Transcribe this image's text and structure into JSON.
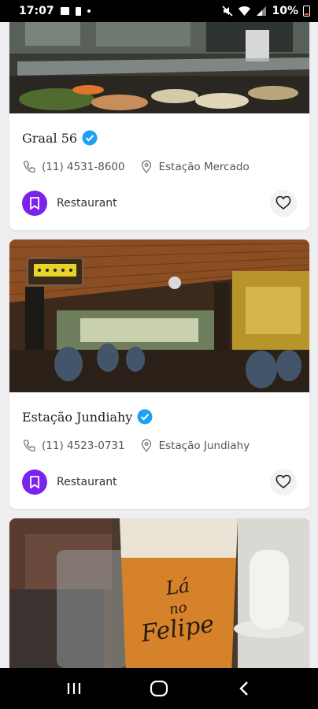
{
  "status_bar": {
    "time": "17:07",
    "battery_percent": "10%",
    "icons": [
      "photo-icon",
      "battery-small-icon",
      "dot-icon",
      "mute-icon",
      "wifi-icon",
      "signal-icon",
      "battery-icon"
    ]
  },
  "cards": [
    {
      "title": "Graal 56",
      "verified": true,
      "phone": "(11) 4531-8600",
      "location": "Estação Mercado",
      "category": "Restaurant",
      "image_desc_icon": "buffet-photo"
    },
    {
      "title": "Estação Jundiahy",
      "verified": true,
      "phone": "(11) 4523-0731",
      "location": "Estação Jundiahy",
      "category": "Restaurant",
      "image_desc_icon": "dining-hall-photo"
    },
    {
      "sign_text": "Lá no Felipe",
      "image_desc_icon": "beer-glass-photo"
    }
  ],
  "colors": {
    "accent_purple": "#7a22ee",
    "verified_blue": "#1da1f2",
    "background": "#eeeef1"
  }
}
